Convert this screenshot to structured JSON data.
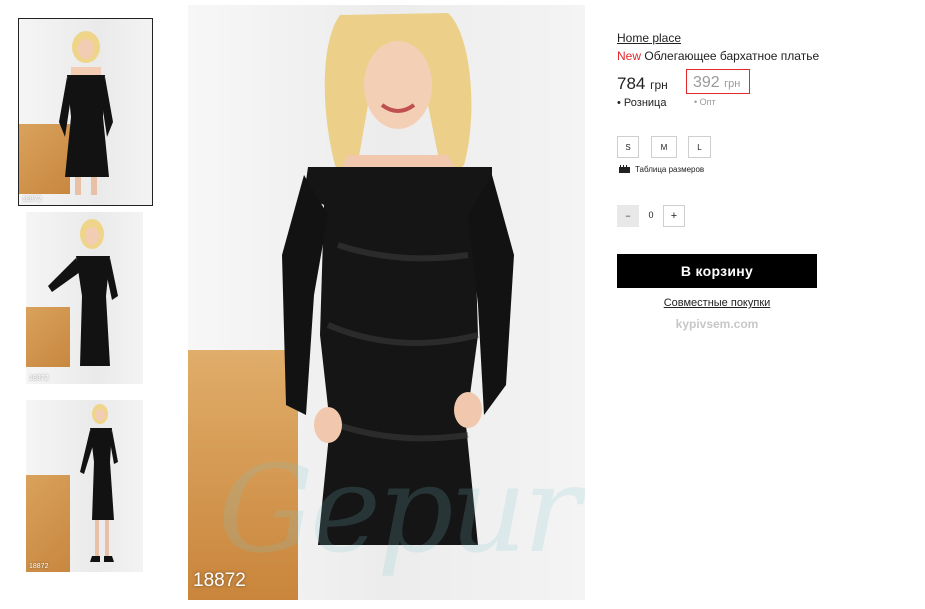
{
  "gallery": {
    "thumbnails": [
      {
        "code": "18872"
      },
      {
        "code": "18872"
      },
      {
        "code": "18872"
      }
    ],
    "main_code": "18872",
    "watermark": "Gepur"
  },
  "product": {
    "breadcrumb": "Home place",
    "new_badge": "New",
    "title": "Облегающее бархатное платье",
    "retail_price": "784",
    "retail_currency": "грн",
    "retail_label": "Розница",
    "opt_price": "392",
    "opt_currency": "грн",
    "opt_label": "Опт",
    "sizes": [
      "S",
      "M",
      "L"
    ],
    "size_table_label": "Таблица размеров",
    "quantity": "0",
    "qty_minus": "−",
    "qty_plus": "+",
    "cart_button": "В корзину",
    "joint_purchase": "Совместные покупки",
    "site": "kypivsem.com"
  },
  "colors": {
    "accent_red": "#e3262b",
    "cart_bg": "#000000"
  }
}
